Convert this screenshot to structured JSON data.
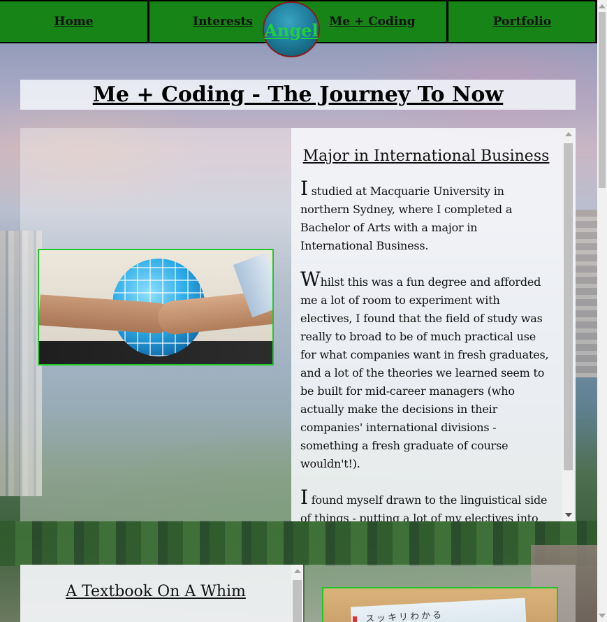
{
  "nav": {
    "items": [
      "Home",
      "Interests",
      "Me + Coding",
      "Portfolio"
    ],
    "logo": "Angel"
  },
  "page": {
    "title": "Me + Coding - The Journey To Now"
  },
  "section1": {
    "heading": "Major in International Business",
    "paragraphs": [
      {
        "dropcap": "I",
        "text": " studied at Macquarie University in northern Sydney, where I completed a Bachelor of Arts with a major in International Business."
      },
      {
        "dropcap": "W",
        "text": "hilst this was a fun degree and afforded me a lot of room to experiment with electives, I found that the field of study was really to broad to be of much practical use for what companies want in fresh graduates, and a lot of the theories we learned seem to be built for mid-career managers (who actually make the decisions in their companies' international divisions - something a fresh graduate of course wouldn't!)."
      },
      {
        "dropcap": "I",
        "text": " found myself drawn to the linguistical side of things - putting a lot of my electives into national languages (amongst other"
      }
    ]
  },
  "section2": {
    "heading": "A Textbook On A Whim",
    "book_text": "スッキリわかる"
  }
}
